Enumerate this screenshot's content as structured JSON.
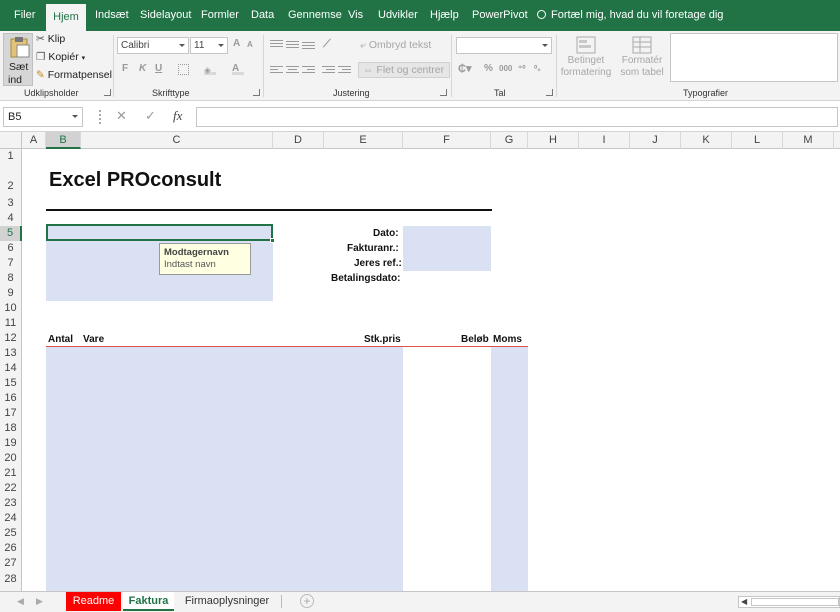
{
  "ribbon_tabs": [
    {
      "label": "Filer",
      "active": false
    },
    {
      "label": "Hjem",
      "active": true
    },
    {
      "label": "Indsæt",
      "active": false
    },
    {
      "label": "Sidelayout",
      "active": false
    },
    {
      "label": "Formler",
      "active": false
    },
    {
      "label": "Data",
      "active": false
    },
    {
      "label": "Gennemse",
      "active": false
    },
    {
      "label": "Vis",
      "active": false
    },
    {
      "label": "Udvikler",
      "active": false
    },
    {
      "label": "Hjælp",
      "active": false
    },
    {
      "label": "PowerPivot",
      "active": false
    }
  ],
  "tell_me": "Fortæl mig, hvad du vil foretage dig",
  "ribbon": {
    "clipboard": {
      "paste_line1": "Sæt",
      "paste_line2": "ind",
      "cut": "Klip",
      "copy": "Kopiér",
      "format_painter": "Formatpensel",
      "group_label": "Udklipsholder"
    },
    "font": {
      "name": "Calibri",
      "size": "11",
      "bold": "F",
      "italic": "K",
      "underline": "U",
      "grow": "A",
      "shrink": "A",
      "group_label": "Skrifttype"
    },
    "alignment": {
      "wrap": "Ombryd tekst",
      "merge": "Flet og centrer",
      "group_label": "Justering"
    },
    "number": {
      "format_value": "",
      "percent": "%",
      "thousands": "000",
      "group_label": "Tal"
    },
    "styles": {
      "conditional_line1": "Betinget",
      "conditional_line2": "formatering",
      "table_line1": "Formatér",
      "table_line2": "som tabel",
      "group_label": "Typografier"
    }
  },
  "formula_bar": {
    "name_box": "B5",
    "cancel": "✕",
    "enter": "✓",
    "fx": "fx",
    "content": ""
  },
  "columns": [
    "A",
    "B",
    "C",
    "D",
    "E",
    "F",
    "G",
    "H",
    "I",
    "J",
    "K",
    "L",
    "M"
  ],
  "selected_column": "B",
  "rows": [
    "1",
    "2",
    "3",
    "4",
    "5",
    "6",
    "7",
    "8",
    "9",
    "10",
    "11",
    "12",
    "13",
    "14",
    "15",
    "16",
    "17",
    "18",
    "19",
    "20",
    "21",
    "22",
    "23",
    "24",
    "25",
    "26",
    "27",
    "28"
  ],
  "selected_row": "5",
  "sheet": {
    "title": "Excel PROconsult",
    "labels": {
      "dato": "Dato:",
      "fakturanr": "Fakturanr.:",
      "jeres_ref": "Jeres ref.:",
      "betalingsdato": "Betalingsdato:"
    },
    "table_headers": {
      "antal": "Antal",
      "vare": "Vare",
      "stkpris": "Stk.pris",
      "beloeb": "Beløb",
      "moms": "Moms"
    },
    "tooltip_title": "Modtagernavn",
    "tooltip_text": "Indtast navn"
  },
  "sheet_tabs": [
    {
      "label": "Readme",
      "active": false,
      "color": "#ff0000"
    },
    {
      "label": "Faktura",
      "active": true,
      "color": "#217346"
    },
    {
      "label": "Firmaoplysninger",
      "active": false,
      "color": ""
    }
  ],
  "colors": {
    "accent": "#217346",
    "input_fill": "#d9e1f2",
    "header_line": "#e05050"
  }
}
